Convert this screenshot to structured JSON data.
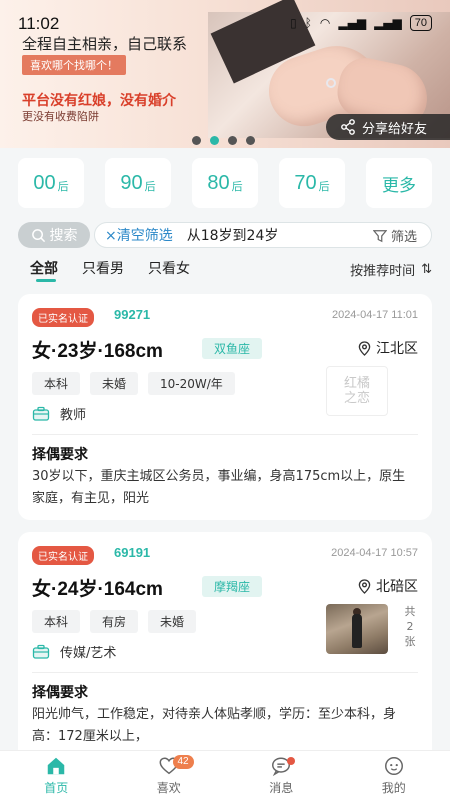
{
  "status": {
    "time": "11:02",
    "battery": "70"
  },
  "banner": {
    "title1": "全程自主相亲，自己联系",
    "pill": "喜欢哪个找哪个！",
    "title2": "平台没有红娘，没有婚介",
    "sub": "更没有收费陷阱",
    "share": "分享给好友",
    "pages": 4,
    "active_page": 1
  },
  "age_filters": [
    {
      "num": "00",
      "suffix": "后"
    },
    {
      "num": "90",
      "suffix": "后"
    },
    {
      "num": "80",
      "suffix": "后"
    },
    {
      "num": "70",
      "suffix": "后"
    }
  ],
  "age_more": "更多",
  "search": {
    "button": "搜索",
    "clear": "×清空筛选",
    "range": "从18岁到24岁",
    "filter": "筛选"
  },
  "tabs": [
    "全部",
    "只看男",
    "只看女"
  ],
  "sort": "按推荐时间",
  "cards": [
    {
      "verified": "已实名认证",
      "id": "99271",
      "date": "2024-04-17 11:01",
      "headline": "女·23岁·168cm",
      "zodiac": "双鱼座",
      "location": "江北区",
      "tags": [
        "本科",
        "未婚",
        "10-20W/年"
      ],
      "job": "教师",
      "logo_line1": "红橘",
      "logo_line2": "之恋",
      "req_title": "择偶要求",
      "req_text": "30岁以下，重庆主城区公务员，事业编，身高175cm以上，原生家庭，有主见，阳光"
    },
    {
      "verified": "已实名认证",
      "id": "69191",
      "date": "2024-04-17 10:57",
      "headline": "女·24岁·164cm",
      "zodiac": "摩羯座",
      "location": "北碚区",
      "tags": [
        "本科",
        "有房",
        "未婚"
      ],
      "job": "传媒/艺术",
      "photo_count_a": "共",
      "photo_count_b": "2",
      "photo_count_c": "张",
      "req_title": "择偶要求",
      "req_text": "阳光帅气，工作稳定，对待亲人体贴孝顺，学历：至少本科，身高：172厘米以上，"
    }
  ],
  "nav": {
    "home": "首页",
    "likes": "喜欢",
    "likes_badge": "42",
    "messages": "消息",
    "mine": "我的"
  },
  "colors": {
    "accent": "#2bb8a8",
    "verified": "#e45843",
    "badge": "#ee7f4d"
  }
}
